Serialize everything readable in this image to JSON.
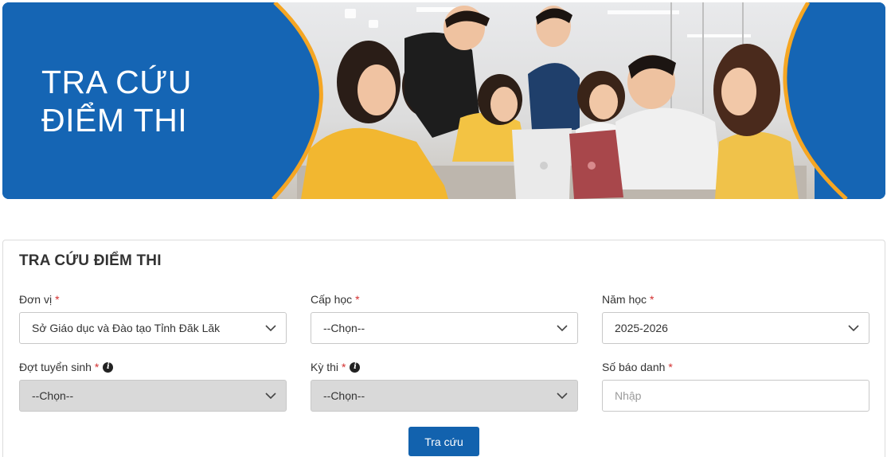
{
  "banner": {
    "title_line1": "TRA CỨU",
    "title_line2": "ĐIỂM THI",
    "colors": {
      "blue": "#1565b4",
      "orange": "#f5a623"
    }
  },
  "form": {
    "title": "TRA CỨU ĐIỂM THI",
    "required_mark": "*",
    "fields": {
      "don_vi": {
        "label": "Đơn vị",
        "value": "Sở Giáo dục và Đào tạo Tỉnh Đăk Lăk"
      },
      "cap_hoc": {
        "label": "Cấp học",
        "value": "--Chọn--"
      },
      "nam_hoc": {
        "label": "Năm học",
        "value": "2025-2026"
      },
      "dot_tuyen_sinh": {
        "label": "Đợt tuyển sinh",
        "value": "--Chọn--"
      },
      "ky_thi": {
        "label": "Kỳ thi",
        "value": "--Chọn--"
      },
      "so_bao_danh": {
        "label": "Số báo danh",
        "placeholder": "Nhập"
      }
    },
    "info_icon": "i",
    "submit_label": "Tra cứu"
  }
}
